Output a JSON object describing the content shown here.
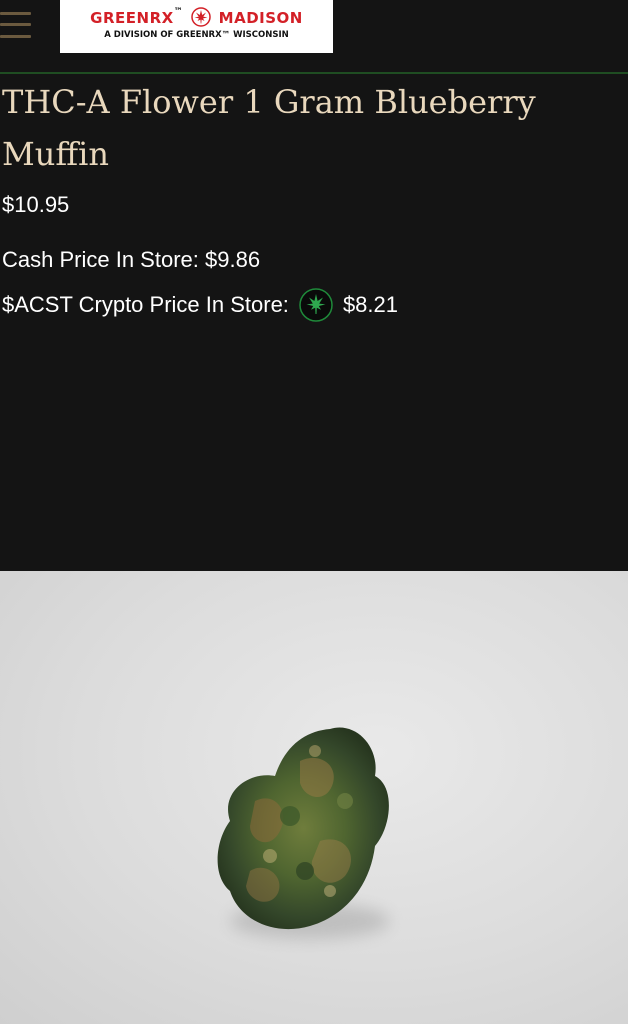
{
  "header": {
    "logo": {
      "brand_left": "GREENRX",
      "tm": "™",
      "brand_right": "MADISON",
      "tagline": "A DIVISION OF GREENRX™ WISCONSIN"
    },
    "icons": {
      "menu": "hamburger-icon",
      "logo_leaf": "cannabis-leaf-icon"
    },
    "colors": {
      "brand_red": "#d32027",
      "title_color": "#e9d8bd",
      "rule_green": "#1f4d22"
    }
  },
  "product": {
    "title": "THC-A Flower 1 Gram Blueberry Muffin",
    "price": "$10.95",
    "cash_label": "Cash Price In Store:",
    "cash_value": "$9.86",
    "crypto_label": "$ACST Crypto Price In Store:",
    "crypto_icon": "green-leaf-coin-icon",
    "crypto_value": "$8.21",
    "image_subject": "cannabis-bud-photo"
  }
}
